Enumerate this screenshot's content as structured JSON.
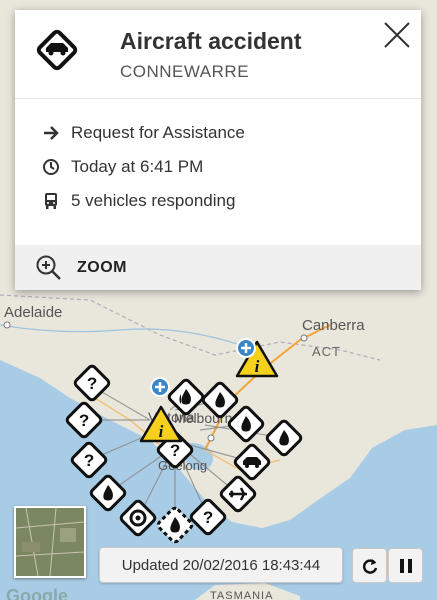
{
  "map": {
    "places": [
      "Adelaide",
      "Canberra",
      "ACT",
      "Victoria",
      "Melbourne",
      "Geelong",
      "TASMANIA"
    ],
    "attribution": "Google"
  },
  "popup": {
    "icon": "car-warning-icon",
    "title": "Aircraft accident",
    "location": "CONNEWARRE",
    "details": [
      {
        "icon": "arrow-right-icon",
        "text": "Request for Assistance"
      },
      {
        "icon": "clock-icon",
        "text": "Today at 6:41 PM"
      },
      {
        "icon": "bus-icon",
        "text": "5 vehicles responding"
      }
    ],
    "zoom_label": "ZOOM",
    "close_icon": "close-icon"
  },
  "status": {
    "updated_text": "Updated 20/02/2016 18:43:44",
    "refresh_icon": "refresh-icon",
    "pause_icon": "pause-icon"
  },
  "colors": {
    "warning_yellow": "#f5d11e",
    "marker_black": "#111111",
    "ocean": "#a9cce6",
    "land": "#e9e6dc",
    "plus_blue": "#3a84c8"
  }
}
